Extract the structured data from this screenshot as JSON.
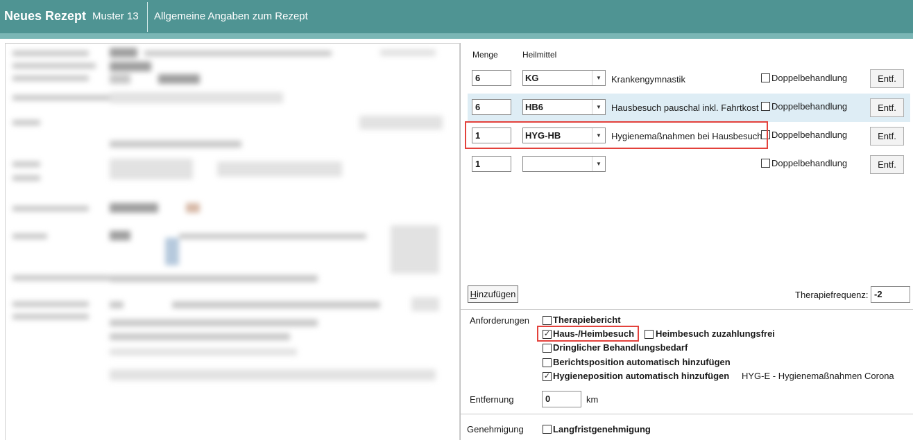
{
  "header": {
    "title": "Neues Rezept",
    "form": "Muster 13",
    "section": "Allgemeine Angaben zum Rezept"
  },
  "colors": {
    "titlebar": "#4f9493",
    "accent_strip": "#7ab6b5",
    "highlight_row": "#deedf5",
    "annotation_red": "#e3413b"
  },
  "table": {
    "col_menge": "Menge",
    "col_heilmittel": "Heilmittel",
    "rows": [
      {
        "menge": "6",
        "code": "KG",
        "description": "Krankengymnastik",
        "double_label": "Doppelbehandlung",
        "double_checked": false,
        "remove_label": "Entf."
      },
      {
        "menge": "6",
        "code": "HB6",
        "description": "Hausbesuch pauschal inkl. Fahrtkost",
        "double_label": "Doppelbehandlung",
        "double_checked": false,
        "remove_label": "Entf."
      },
      {
        "menge": "1",
        "code": "HYG-HB",
        "description": "Hygienemaßnahmen bei Hausbesuch",
        "double_label": "Doppelbehandlung",
        "double_checked": false,
        "remove_label": "Entf."
      },
      {
        "menge": "1",
        "code": "",
        "description": "",
        "double_label": "Doppelbehandlung",
        "double_checked": false,
        "remove_label": "Entf."
      }
    ]
  },
  "add_button": "Hinzufügen",
  "frequency": {
    "label": "Therapiefrequenz:",
    "value": "-2"
  },
  "requirements": {
    "label": "Anforderungen",
    "items": [
      {
        "label": "Therapiebericht",
        "checked": false
      },
      {
        "label": "Haus-/Heimbesuch",
        "checked": true
      },
      {
        "label": "Heimbesuch zuzahlungsfrei",
        "checked": false
      },
      {
        "label": "Dringlicher Behandlungsbedarf",
        "checked": false
      },
      {
        "label": "Berichtsposition automatisch hinzufügen",
        "checked": false
      },
      {
        "label": "Hygieneposition automatisch hinzufügen",
        "checked": true
      }
    ],
    "hygiene_info": "HYG-E - Hygienemaßnahmen Corona"
  },
  "distance": {
    "label": "Entfernung",
    "value": "0",
    "unit": "km"
  },
  "approval": {
    "label": "Genehmigung",
    "checkbox_label": "Langfristgenehmigung",
    "checked": false
  },
  "icons": {
    "dropdown": "chevron-down-icon",
    "check": "checkmark-icon"
  }
}
